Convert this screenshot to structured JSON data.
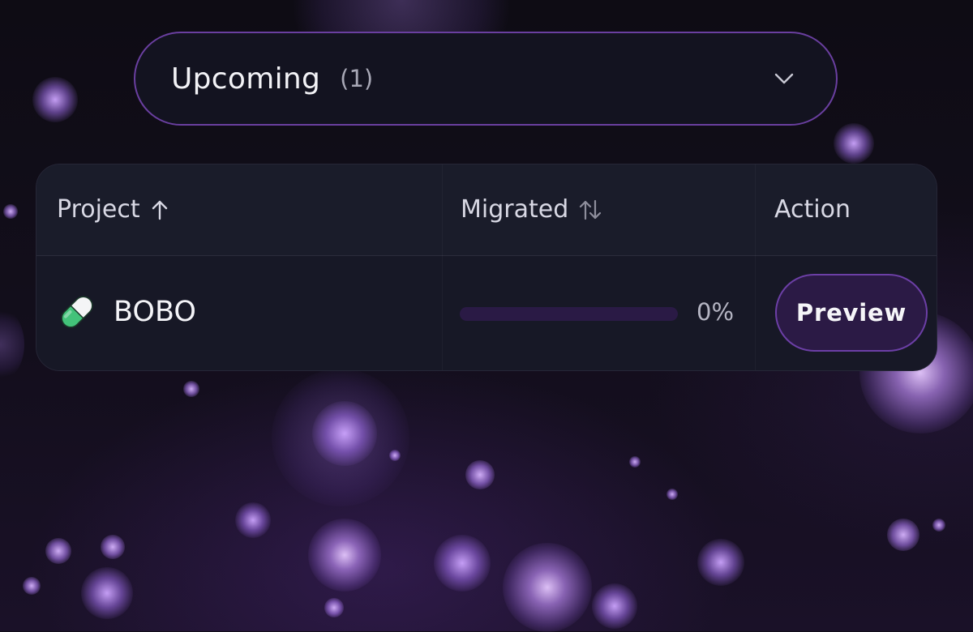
{
  "dropdown": {
    "label": "Upcoming",
    "count": "(1)",
    "icon": "chevron-down-icon"
  },
  "table": {
    "headers": {
      "project": "Project",
      "migrated": "Migrated",
      "action": "Action"
    },
    "header_icons": {
      "project": "arrow-up-icon",
      "migrated": "sort-icon"
    },
    "rows": [
      {
        "icon": "pill-icon",
        "name": "BOBO",
        "migrated_fraction": 0,
        "migrated_label": "0%",
        "action_label": "Preview"
      }
    ]
  },
  "colors": {
    "accent": "#6c3fa6",
    "button_bg": "#2b1a45",
    "progress_track": "#2a1a45",
    "pill_green": "#3fbf6f"
  }
}
